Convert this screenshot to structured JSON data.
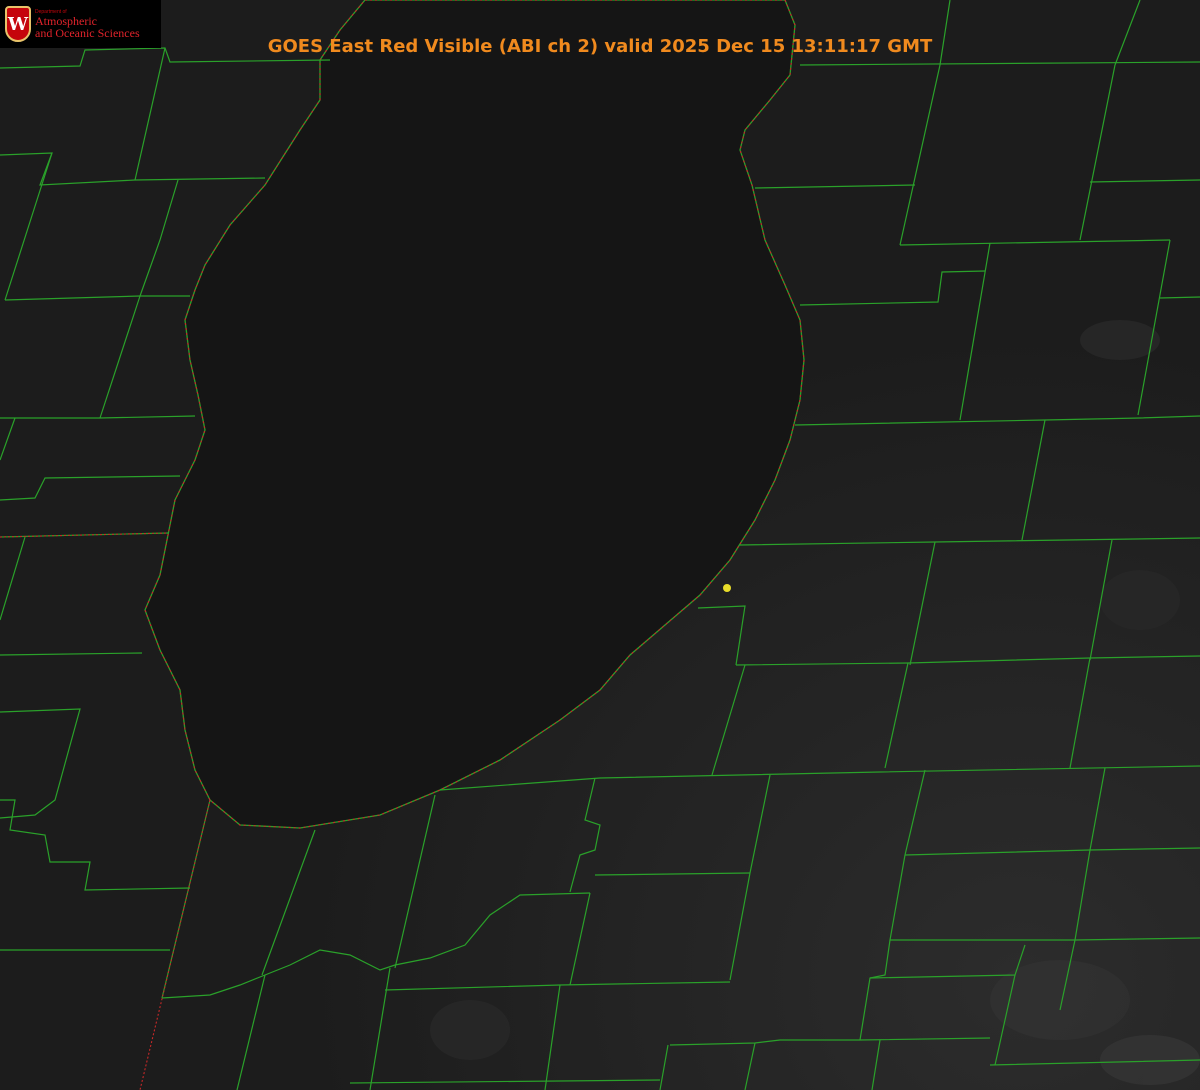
{
  "title": "GOES East Red Visible (ABI ch 2) valid 2025 Dec 15 13:11:17 GMT",
  "logo": {
    "department": "Department of",
    "line1": "Atmospheric",
    "line2": "and Oceanic Sciences",
    "crest_letter": "W"
  },
  "colors": {
    "background_land": "#1c1c1c",
    "lake": "#161616",
    "county_lines": "#2aa12a",
    "state_boundary": "#c62828",
    "title": "#f08a1e",
    "marker": "#e8dc2a"
  },
  "map": {
    "subject": "Lake Michigan (southern basin)",
    "layers": [
      "county-boundaries",
      "state-boundaries",
      "coastline"
    ],
    "marker": {
      "type": "point",
      "color_name": "yellow"
    }
  }
}
